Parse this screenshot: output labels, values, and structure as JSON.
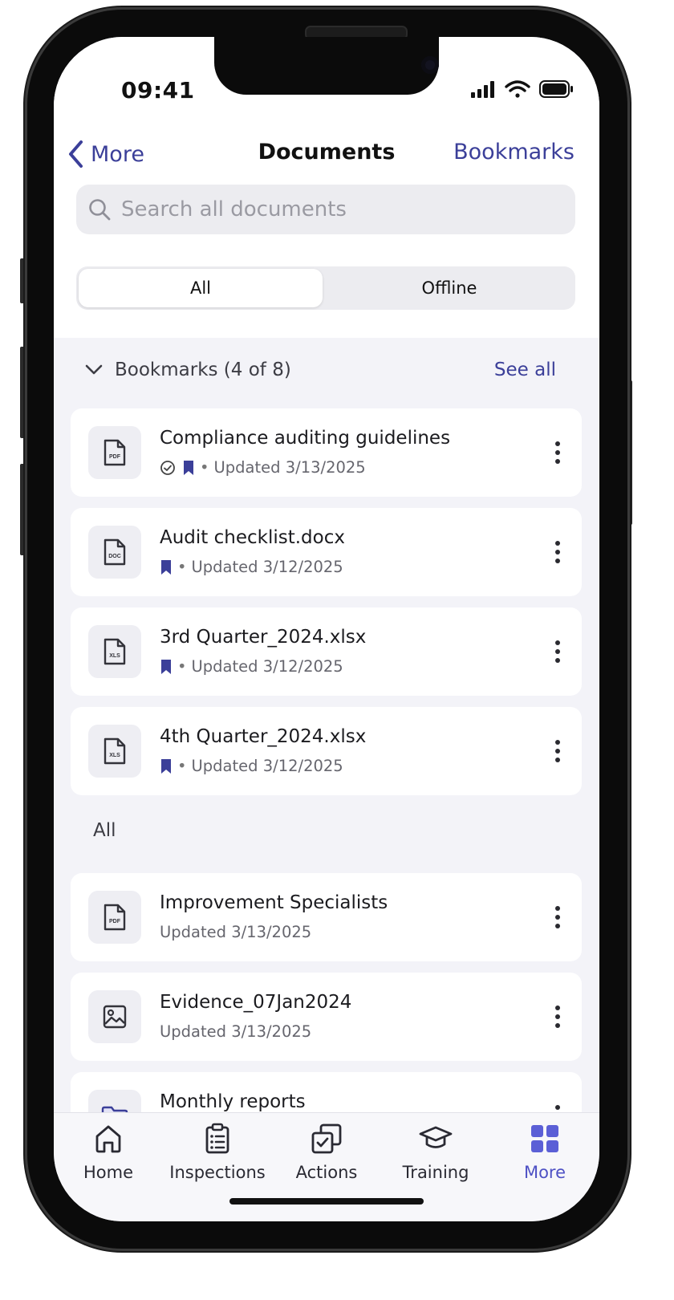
{
  "status_bar": {
    "time": "09:41"
  },
  "nav": {
    "back_label": "More",
    "title": "Documents",
    "right_label": "Bookmarks"
  },
  "search": {
    "placeholder": "Search all documents"
  },
  "segments": {
    "all": "All",
    "offline": "Offline",
    "selected": "All"
  },
  "bookmarks_section": {
    "header": "Bookmarks (4 of 8)",
    "see_all": "See all"
  },
  "bookmarks": [
    {
      "title": "Compliance auditing guidelines",
      "type": "PDF",
      "offline": true,
      "bookmarked": true,
      "updated": "Updated 3/13/2025"
    },
    {
      "title": "Audit checklist.docx",
      "type": "DOC",
      "offline": false,
      "bookmarked": true,
      "updated": "Updated 3/12/2025"
    },
    {
      "title": "3rd Quarter_2024.xlsx",
      "type": "XLS",
      "offline": false,
      "bookmarked": true,
      "updated": "Updated 3/12/2025"
    },
    {
      "title": "4th Quarter_2024.xlsx",
      "type": "XLS",
      "offline": false,
      "bookmarked": true,
      "updated": "Updated 3/12/2025"
    }
  ],
  "all_section": {
    "header": "All"
  },
  "all_documents": [
    {
      "title": "Improvement Specialists",
      "type": "PDF",
      "updated": "Updated 3/13/2025"
    },
    {
      "title": "Evidence_07Jan2024",
      "type": "image",
      "updated": "Updated 3/13/2025"
    },
    {
      "title": "Monthly reports",
      "type": "folder"
    }
  ],
  "tabbar": {
    "tabs": [
      "Home",
      "Inspections",
      "Actions",
      "Training",
      "More"
    ],
    "active": "More"
  },
  "colors": {
    "accent": "#3b3f99",
    "active_tab": "#5b5fd6",
    "bookmark": "#3b3f99"
  }
}
